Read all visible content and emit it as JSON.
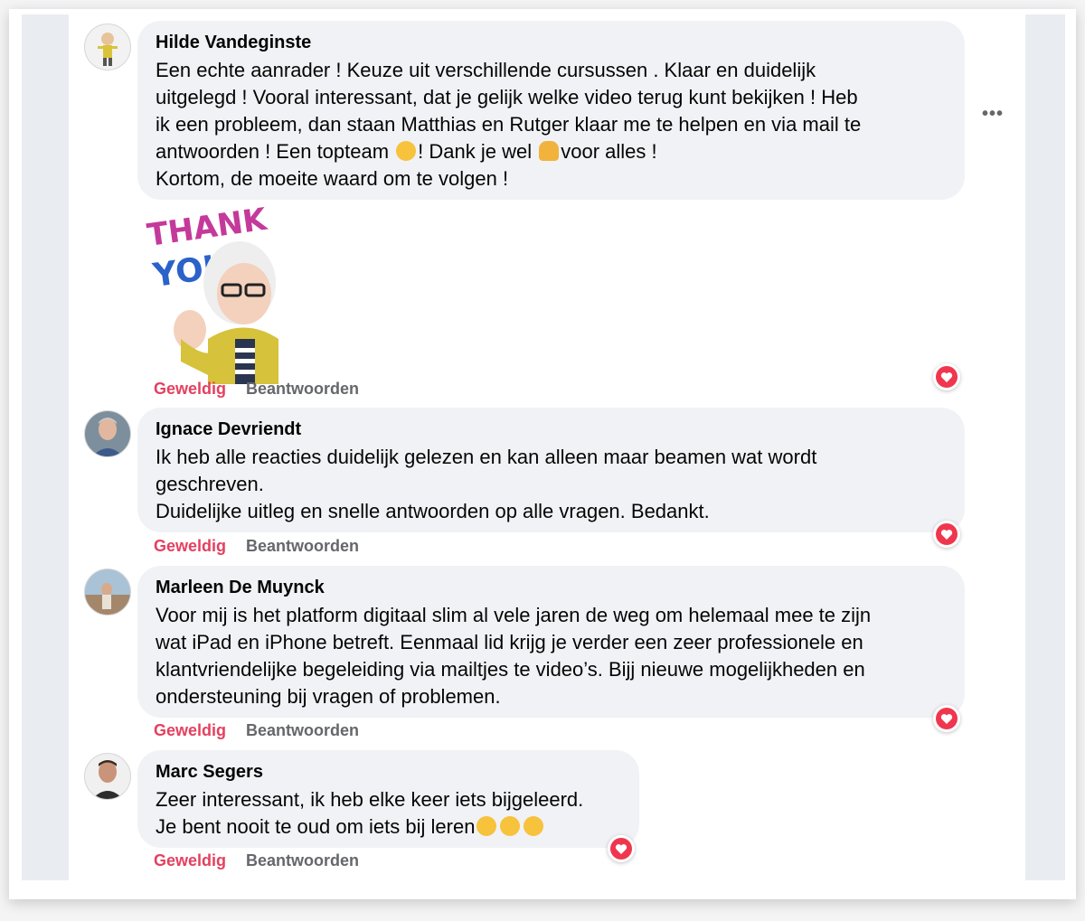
{
  "comments": [
    {
      "name": "Hilde Vandeginste",
      "line1": "Een echte aanrader ! Keuze uit verschillende cursussen . Klaar en duidelijk",
      "line2": "uitgelegd ! Vooral interessant, dat je gelijk welke video terug kunt bekijken ! Heb",
      "line3": "ik een probleem, dan staan Matthias en Rutger klaar me te helpen en via mail te",
      "line4a": "antwoorden ! Een topteam ",
      "line4b": "! Dank je wel ",
      "line4c": "voor alles !",
      "line5": "Kortom, de moeite waard om te volgen !",
      "like": "Geweldig",
      "reply": "Beantwoorden"
    },
    {
      "name": "Ignace Devriendt",
      "text": "Ik heb alle reacties duidelijk gelezen en kan alleen maar beamen wat wordt\ngeschreven.\nDuidelijke uitleg en snelle antwoorden op alle vragen. Bedankt.",
      "like": "Geweldig",
      "reply": "Beantwoorden"
    },
    {
      "name": "Marleen De Muynck",
      "text": "Voor mij is het platform digitaal slim al vele jaren de weg om helemaal mee te zijn\nwat iPad en iPhone betreft. Eenmaal lid krijg je verder een zeer professionele en\nklantvriendelijke begeleiding via mailtjes te video’s. Bijj nieuwe mogelijkheden en\nondersteuning bij vragen of problemen.",
      "like": "Geweldig",
      "reply": "Beantwoorden"
    },
    {
      "name": "Marc Segers",
      "line1": "Zeer interessant, ik heb elke keer iets bijgeleerd.",
      "line2": "Je bent nooit te oud om iets bij leren",
      "like": "Geweldig",
      "reply": "Beantwoorden"
    }
  ],
  "sticker": {
    "text_top": "THANK",
    "text_bottom": "YOU"
  },
  "more_menu": "•••",
  "colors": {
    "like": "#e4405f",
    "bubble": "#f0f2f5",
    "heart": "#f0364f"
  }
}
